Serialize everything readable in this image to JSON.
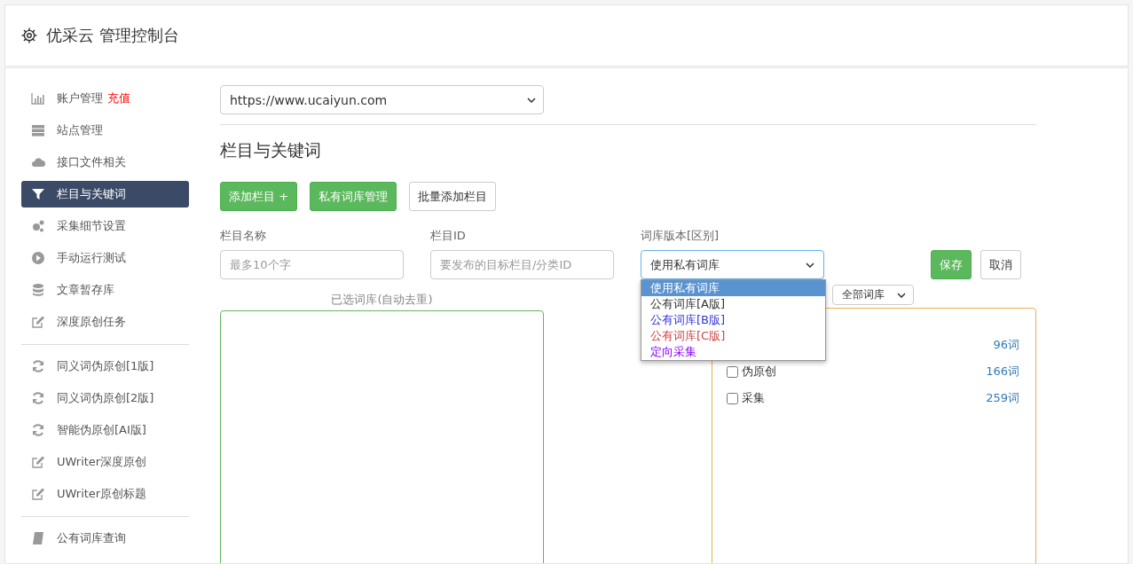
{
  "header": {
    "title": "优采云 管理控制台"
  },
  "sidebar": {
    "groups": [
      [
        {
          "label": "账户管理",
          "badge": "充值",
          "selected": false
        },
        {
          "label": "站点管理",
          "selected": false
        },
        {
          "label": "接口文件相关",
          "selected": false
        },
        {
          "label": "栏目与关键词",
          "selected": true
        },
        {
          "label": "采集细节设置",
          "selected": false
        },
        {
          "label": "手动运行测试",
          "selected": false
        },
        {
          "label": "文章暂存库",
          "selected": false
        },
        {
          "label": "深度原创任务",
          "selected": false
        }
      ],
      [
        {
          "label": "同义词伪原创[1版]",
          "selected": false
        },
        {
          "label": "同义词伪原创[2版]",
          "selected": false
        },
        {
          "label": "智能伪原创[AI版]",
          "selected": false
        },
        {
          "label": "UWriter深度原创",
          "selected": false
        },
        {
          "label": "UWriter原创标题",
          "selected": false
        }
      ],
      [
        {
          "label": "公有词库查询",
          "selected": false
        }
      ]
    ]
  },
  "site_select": {
    "value": "https://www.ucaiyun.com"
  },
  "section_title": "栏目与关键词",
  "actions": [
    {
      "label": "添加栏目 +",
      "kind": "primary"
    },
    {
      "label": "私有词库管理",
      "kind": "primary"
    },
    {
      "label": "批量添加栏目",
      "kind": "default"
    }
  ],
  "form": {
    "name": {
      "label": "栏目名称",
      "placeholder": "最多10个字"
    },
    "id": {
      "label": "栏目ID",
      "placeholder": "要发布的目标栏目/分类ID"
    },
    "version": {
      "label": "词库版本[区别]",
      "value": "使用私有词库",
      "expanded": true,
      "options": [
        {
          "label": "使用私有词库",
          "selected": true
        },
        {
          "label": "公有词库[A版]",
          "selected": false
        },
        {
          "label": "公有词库[B版]",
          "selected": false,
          "color": "#3333dd"
        },
        {
          "label": "公有词库[C版]",
          "selected": false,
          "color": "#cc4444"
        },
        {
          "label": "定向采集",
          "selected": false,
          "color": "#8800ff"
        }
      ]
    },
    "save": "保存",
    "cancel": "取消"
  },
  "selected_lib": {
    "label": "已选词库(自动去重)"
  },
  "lib_filter": {
    "value": "全部词库"
  },
  "libs": [
    {
      "count": "96词"
    },
    {
      "name": "伪原创",
      "count": "166词",
      "checked": false
    },
    {
      "name": "采集",
      "count": "259词",
      "checked": false
    }
  ]
}
